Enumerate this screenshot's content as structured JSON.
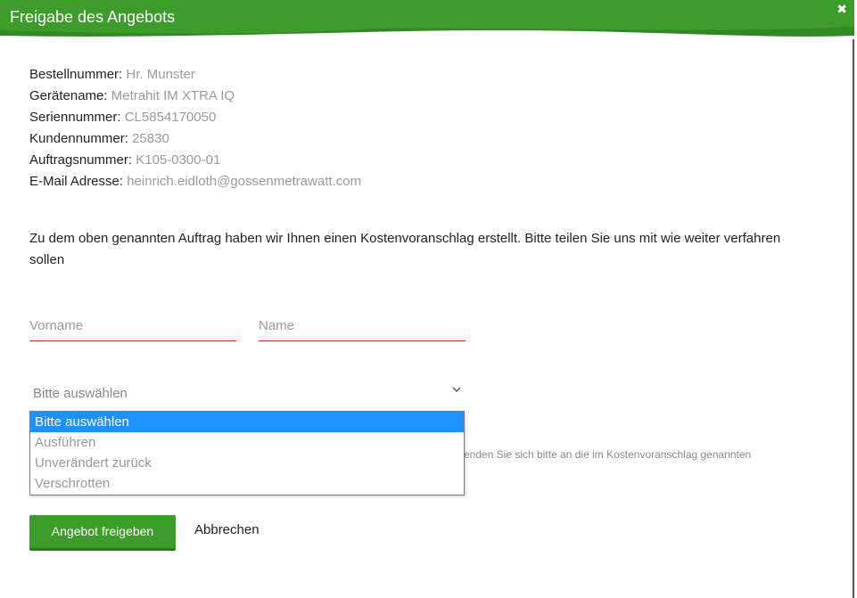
{
  "header": {
    "title": "Freigabe des Angebots",
    "close_glyph": "✖"
  },
  "colors": {
    "brand_green": "#3c9d2b",
    "brand_green_dark": "#2c7a1f",
    "error_line": "#c8322c",
    "option_highlight": "#1e90ff"
  },
  "info": [
    {
      "label": "Bestellnummer",
      "value": "Hr. Munster"
    },
    {
      "label": "Gerätename",
      "value": "Metrahit IM XTRA IQ"
    },
    {
      "label": "Seriennummer",
      "value": "CL5854170050"
    },
    {
      "label": "Kundennummer",
      "value": "25830"
    },
    {
      "label": "Auftragsnummer",
      "value": "K105-0300-01"
    },
    {
      "label": "E-Mail Adresse",
      "value": "heinrich.eidloth@gossenmetrawatt.com"
    }
  ],
  "separator": ": ",
  "intro": "Zu dem oben genannten Auftrag haben wir Ihnen einen Kostenvoranschlag erstellt. Bitte teilen Sie uns mit wie weiter verfahren sollen",
  "form": {
    "firstname_placeholder": "Vorname",
    "lastname_placeholder": "Name",
    "select_value": "Bitte auswählen",
    "options": [
      "Bitte auswählen",
      "Ausführen",
      "Unverändert zurück",
      "Verschrotten"
    ],
    "note": "enden Sie sich bitte an die im Kostenvoranschlag genannten"
  },
  "buttons": {
    "submit": "Angebot freigeben",
    "cancel": "Abbrechen"
  },
  "icons": {
    "close": "close-icon",
    "chevron": "chevron-down-icon"
  }
}
